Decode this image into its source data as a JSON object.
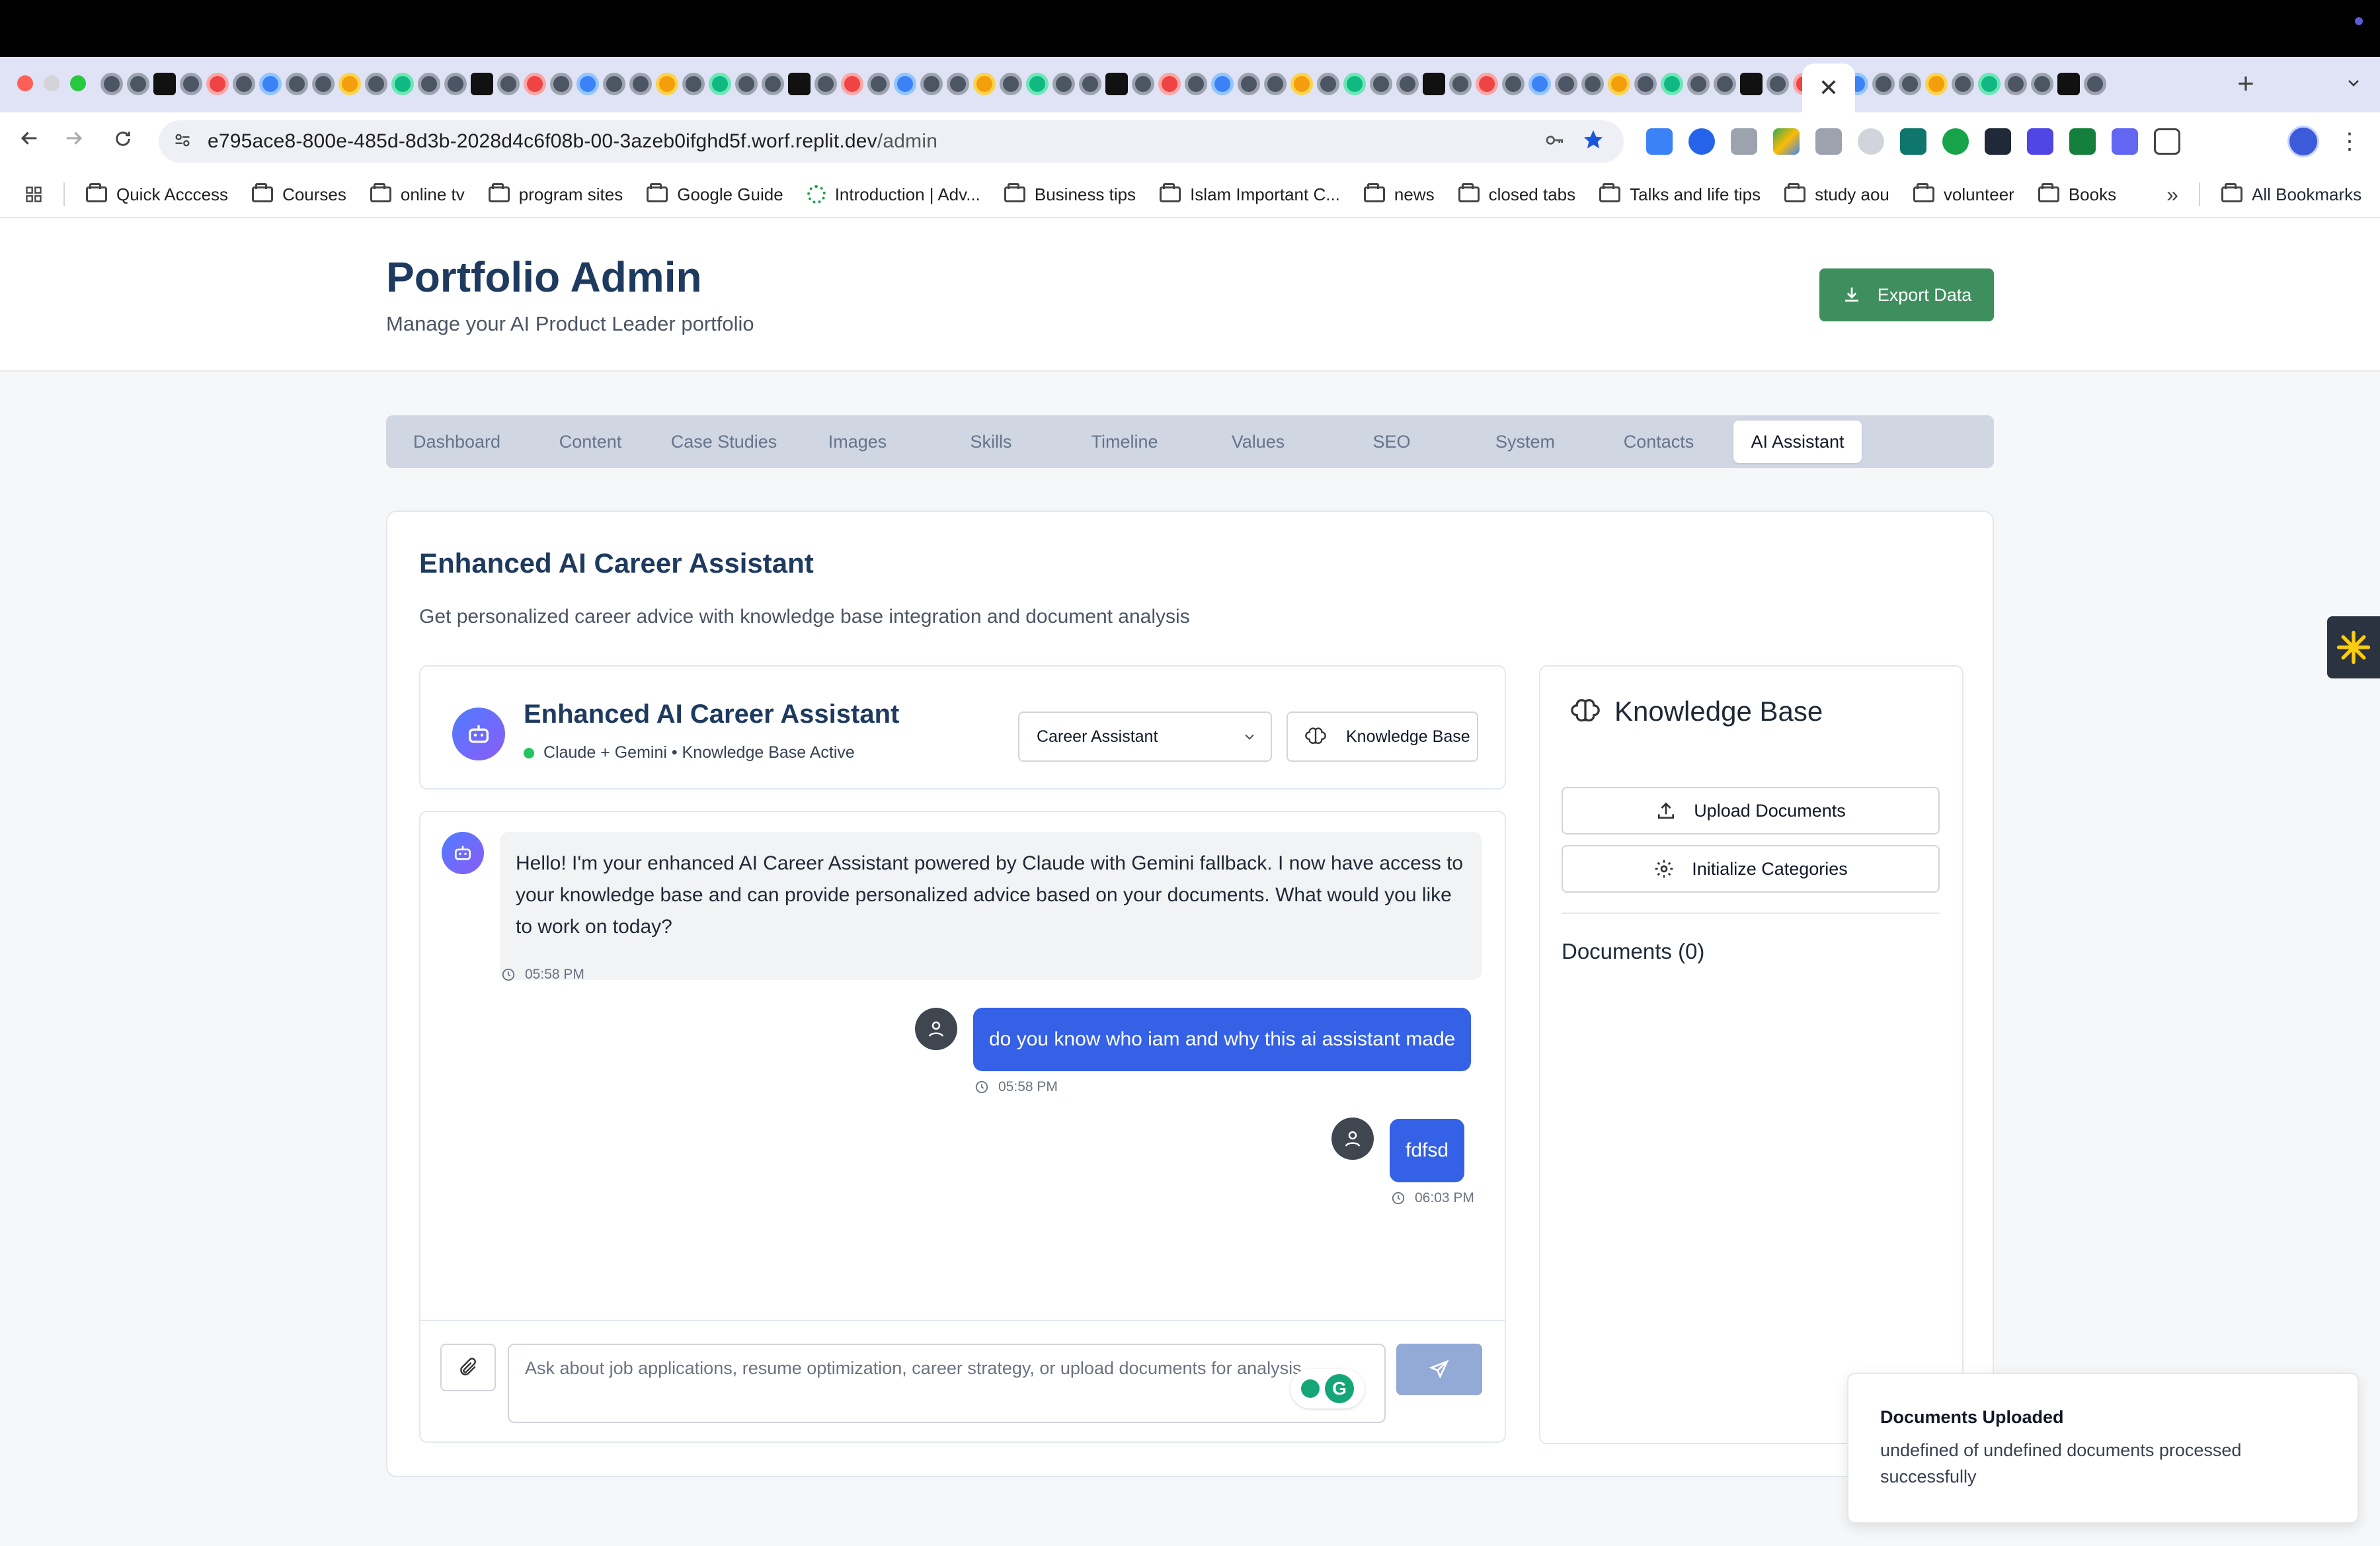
{
  "browser": {
    "active_tab_close": "✕",
    "new_tab": "+",
    "url_host": "e795ace8-800e-485d-8d3b-2028d4c6f08b-00-3azeb0ifghd5f.worf.replit.dev",
    "url_path": "/admin",
    "bookmarks": [
      {
        "label": "Quick Acccess",
        "icon": "folder-icon"
      },
      {
        "label": "Courses",
        "icon": "folder-icon"
      },
      {
        "label": "online tv",
        "icon": "folder-icon"
      },
      {
        "label": "program sites",
        "icon": "folder-icon"
      },
      {
        "label": "Google Guide",
        "icon": "folder-icon"
      },
      {
        "label": "Introduction | Adv...",
        "icon": "site-icon"
      },
      {
        "label": "Business tips",
        "icon": "folder-icon"
      },
      {
        "label": "Islam Important C...",
        "icon": "folder-icon"
      },
      {
        "label": "news",
        "icon": "folder-icon"
      },
      {
        "label": "closed tabs",
        "icon": "folder-icon"
      },
      {
        "label": "Talks and life tips",
        "icon": "folder-icon"
      },
      {
        "label": "study aou",
        "icon": "folder-icon"
      },
      {
        "label": "volunteer",
        "icon": "folder-icon"
      },
      {
        "label": "Books",
        "icon": "folder-icon"
      }
    ],
    "bookmarks_overflow": "»",
    "all_bookmarks": "All Bookmarks"
  },
  "header": {
    "title": "Portfolio Admin",
    "subtitle": "Manage your AI Product Leader portfolio",
    "export_label": "Export Data"
  },
  "tabs": [
    {
      "label": "Dashboard",
      "active": false
    },
    {
      "label": "Content",
      "active": false
    },
    {
      "label": "Case Studies",
      "active": false
    },
    {
      "label": "Images",
      "active": false
    },
    {
      "label": "Skills",
      "active": false
    },
    {
      "label": "Timeline",
      "active": false
    },
    {
      "label": "Values",
      "active": false
    },
    {
      "label": "SEO",
      "active": false
    },
    {
      "label": "System",
      "active": false
    },
    {
      "label": "Contacts",
      "active": false
    },
    {
      "label": "AI Assistant",
      "active": true
    }
  ],
  "assistant": {
    "card_title": "Enhanced AI Career Assistant",
    "card_description": "Get personalized career advice with knowledge base integration and document analysis",
    "chat_title": "Enhanced AI Career Assistant",
    "status_text": "Claude + Gemini • Knowledge Base Active",
    "mode_selected": "Career Assistant",
    "kb_button": "Knowledge Base",
    "messages": [
      {
        "role": "assistant",
        "text": "Hello! I'm your enhanced AI Career Assistant powered by Claude with Gemini fallback. I now have access to your knowledge base and can provide personalized advice based on your documents. What would you like to work on today?",
        "time": "05:58 PM"
      },
      {
        "role": "user",
        "text": "do you know who iam and why this ai assistant made",
        "time": "05:58 PM"
      },
      {
        "role": "user",
        "text": "fdfsd",
        "time": "06:03 PM"
      }
    ],
    "input_placeholder": "Ask about job applications, resume optimization, career strategy, or upload documents for analysis..."
  },
  "knowledge_base": {
    "title": "Knowledge Base",
    "upload_label": "Upload Documents",
    "init_label": "Initialize Categories",
    "documents_heading": "Documents (0)"
  },
  "toast": {
    "title": "Documents Uploaded",
    "description": "undefined of undefined documents processed successfully"
  },
  "colors": {
    "accent_green": "#3f8f5e",
    "user_bubble": "#3461e6",
    "title_navy": "#1e3a5f",
    "send_disabled": "#93a9d6"
  }
}
